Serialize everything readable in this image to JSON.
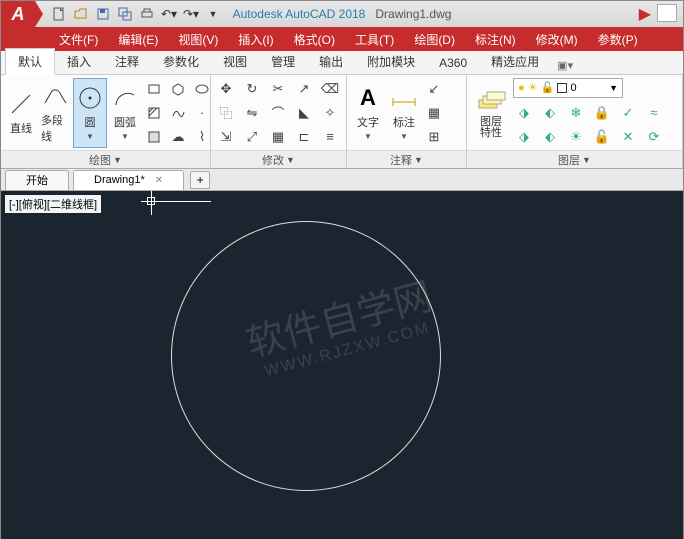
{
  "app": {
    "logo": "A",
    "title_app": "Autodesk AutoCAD 2018",
    "title_doc": "Drawing1.dwg"
  },
  "qat": [
    "new",
    "open",
    "save",
    "saveas",
    "print",
    "undo",
    "redo"
  ],
  "menus": [
    "文件(F)",
    "编辑(E)",
    "视图(V)",
    "插入(I)",
    "格式(O)",
    "工具(T)",
    "绘图(D)",
    "标注(N)",
    "修改(M)",
    "参数(P)"
  ],
  "ribbon_tabs": [
    "默认",
    "插入",
    "注释",
    "参数化",
    "视图",
    "管理",
    "输出",
    "附加模块",
    "A360",
    "精选应用"
  ],
  "ribbon_active": 0,
  "panels": {
    "draw": {
      "title": "绘图",
      "big": [
        {
          "name": "line",
          "label": "直线"
        },
        {
          "name": "polyline",
          "label": "多段线"
        },
        {
          "name": "circle",
          "label": "圆",
          "selected": true
        },
        {
          "name": "arc",
          "label": "圆弧"
        }
      ],
      "small": [
        "rect",
        "poly-insc",
        "ellipse",
        "hatch",
        "spline",
        "point",
        "region",
        "revcloud",
        "helix"
      ]
    },
    "modify": {
      "title": "修改",
      "small": [
        "move",
        "rotate",
        "trim",
        "copy",
        "mirror",
        "fillet",
        "stretch",
        "scale",
        "array",
        "erase",
        "explode",
        "offset",
        "chamfer",
        "align",
        "break"
      ]
    },
    "annotate": {
      "title": "注释",
      "big": [
        {
          "name": "text",
          "label": "文字"
        },
        {
          "name": "dim",
          "label": "标注"
        }
      ],
      "small": [
        "leader",
        "table",
        "mtext",
        "field"
      ]
    },
    "layers": {
      "title": "图层",
      "big": {
        "name": "layerprops",
        "label": "图层\n特性"
      },
      "combo": "0",
      "small": [
        "layoff",
        "layiso",
        "layfrz",
        "laylck",
        "laymcur",
        "laymch",
        "layon",
        "layuniso",
        "laythw",
        "layunlk",
        "laydel",
        "laywalk"
      ]
    }
  },
  "doc_tabs": [
    {
      "label": "开始",
      "active": false
    },
    {
      "label": "Drawing1*",
      "active": true
    }
  ],
  "viewport_label": "[-][俯视][二维线框]",
  "watermark": {
    "main": "软件自学网",
    "sub": "WWW.RJZXW.COM"
  }
}
